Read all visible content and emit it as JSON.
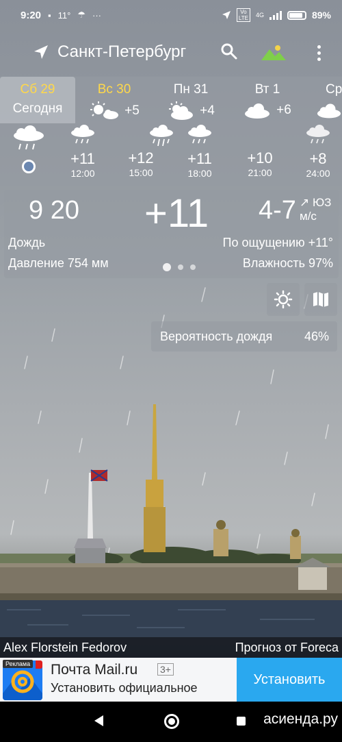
{
  "status": {
    "time": "9:20",
    "temp": "11°",
    "lte_label": "Vo LTE",
    "net_label": "4G",
    "battery": "89%",
    "battery_level": 0.89
  },
  "app": {
    "city": "Санкт-Петербург"
  },
  "days": [
    {
      "name": "Сб 29",
      "sub": "Сегодня",
      "selected": true
    },
    {
      "name": "Вс 30",
      "temp": "+5",
      "icon": "sun-cloud-icon"
    },
    {
      "name": "Пн 31",
      "temp": "+4",
      "icon": "sun-cloud-icon"
    },
    {
      "name": "Вт 1",
      "temp": "+6",
      "icon": "cloud-icon"
    },
    {
      "name": "Ср",
      "temp": "",
      "icon": "cloud-icon"
    }
  ],
  "hours": [
    {
      "temp": "",
      "time": "",
      "icon": "rain-cloud-icon",
      "now": true
    },
    {
      "temp": "+11",
      "time": "12:00",
      "icon": "rain-cloud-icon"
    },
    {
      "temp": "+12",
      "time": "15:00",
      "icon": ""
    },
    {
      "temp": "+11",
      "time": "18:00",
      "icon": "rain-cloud-icon"
    },
    {
      "temp": "+10",
      "time": "21:00",
      "icon": ""
    },
    {
      "temp": "+8",
      "time": "24:00",
      "icon": "rain-cloud-icon"
    }
  ],
  "current": {
    "time": "9 20",
    "temp": "+11",
    "wind": "4-7",
    "wind_dir": "ЮЗ",
    "wind_unit": "м/с",
    "condition": "Дождь",
    "feels_like": "По ощущению +11°",
    "pressure": "Давление 754 мм",
    "humidity": "Влажность 97%"
  },
  "rain_probability": {
    "label": "Вероятность дождя",
    "value": "46%"
  },
  "credits": {
    "photographer": "Alex Florstein Fedorov",
    "forecast": "Прогноз от Foreca"
  },
  "ad": {
    "tag": "Реклама",
    "title": "Почта Mail.ru",
    "age": "3+",
    "subtitle": "Установить официальное",
    "button": "Установить"
  },
  "watermark": "асиенда.ру",
  "colors": {
    "accent_yellow": "#ffd84a",
    "ad_button": "#2aa8ef"
  }
}
